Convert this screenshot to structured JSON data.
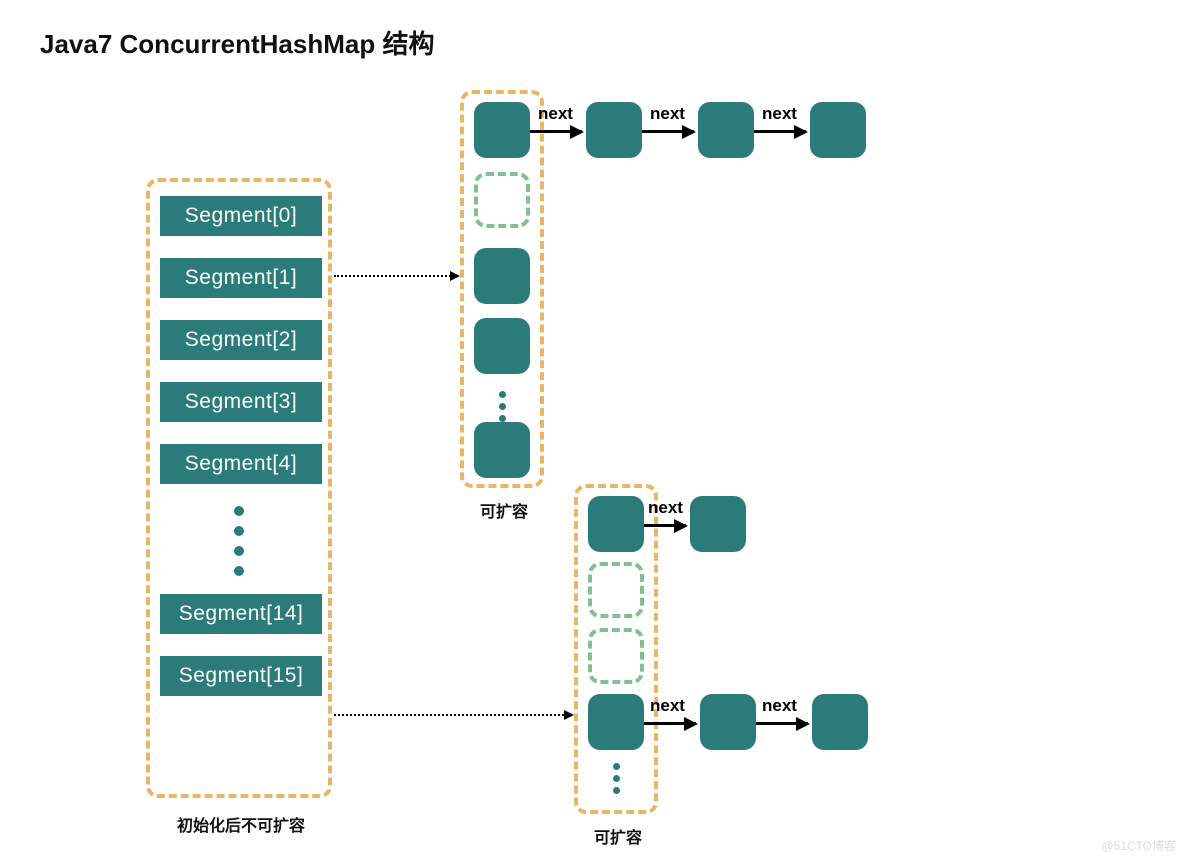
{
  "title": "Java7 ConcurrentHashMap 结构",
  "segments_caption": "初始化后不可扩容",
  "entry_caption": "可扩容",
  "next_label": "next",
  "segments": [
    "Segment[0]",
    "Segment[1]",
    "Segment[2]",
    "Segment[3]",
    "Segment[4]",
    "Segment[14]",
    "Segment[15]"
  ],
  "watermark": "@51CTO博客",
  "colors": {
    "teal": "#2c7b7b",
    "dash_orange": "#e9b764",
    "dash_green": "#7fc191"
  }
}
